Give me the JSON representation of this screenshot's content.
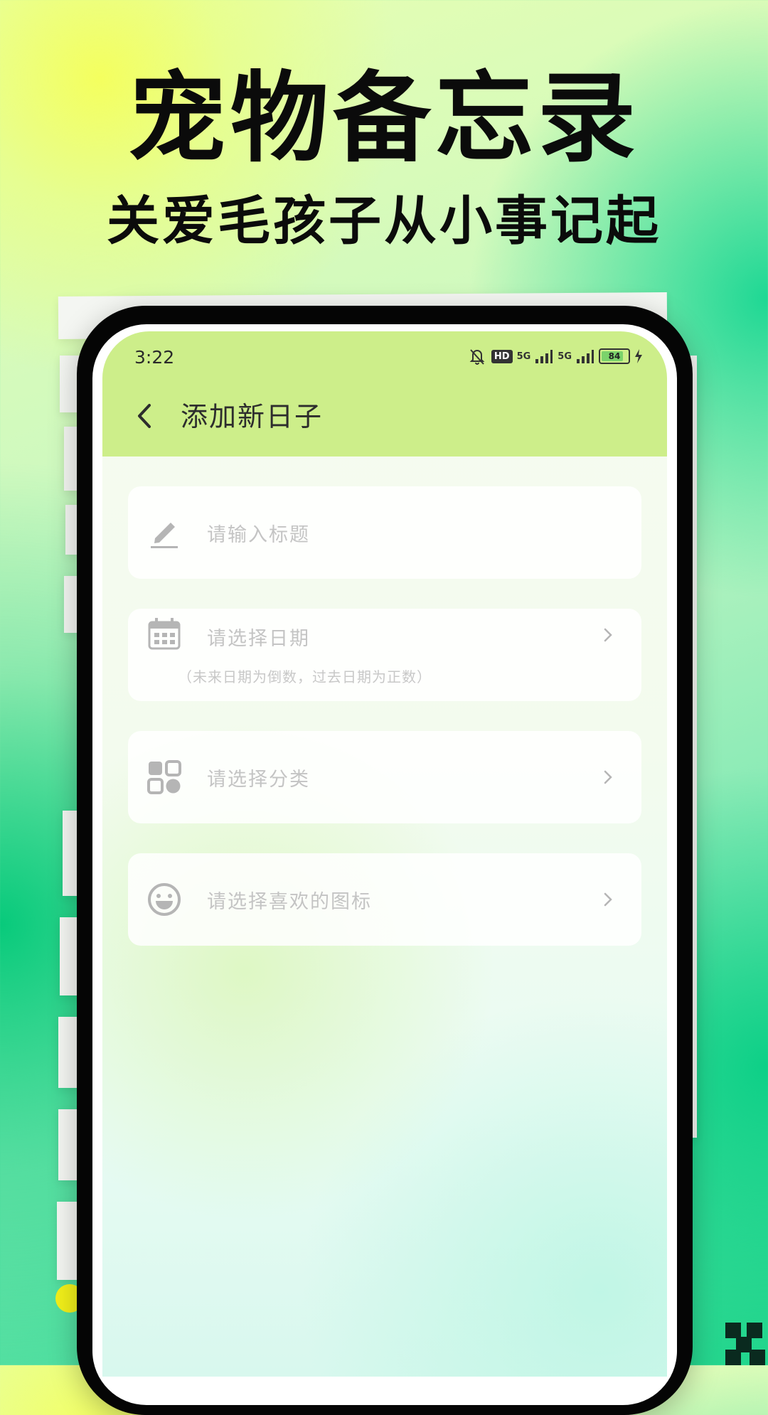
{
  "promo": {
    "title": "宠物备忘录",
    "subtitle": "关爱毛孩子从小事记起"
  },
  "status_bar": {
    "time": "3:22",
    "network_1": "5G",
    "network_2": "5G",
    "hd": "HD",
    "battery": "84"
  },
  "nav": {
    "back_icon": "chevron-left-icon",
    "title": "添加新日子"
  },
  "form": {
    "title_placeholder": "请输入标题",
    "date_placeholder": "请选择日期",
    "date_hint": "（未来日期为倒数，过去日期为正数）",
    "category_placeholder": "请选择分类",
    "icon_placeholder": "请选择喜欢的图标"
  },
  "colors": {
    "topbar": "#cdee8a",
    "icon_gray": "#b5b5b5",
    "placeholder_gray": "#c4c4c4"
  }
}
